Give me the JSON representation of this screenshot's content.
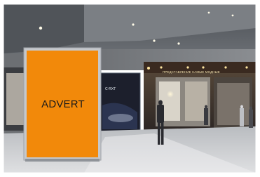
{
  "scene": {
    "billboard_text": "ADVERT",
    "billboard_color": "#f2890a",
    "store_sign_text": "ПРЕДСТАВЛЕНИЕ САМЫЕ МОДНЫЕ",
    "poster_text": "C-RXT"
  }
}
